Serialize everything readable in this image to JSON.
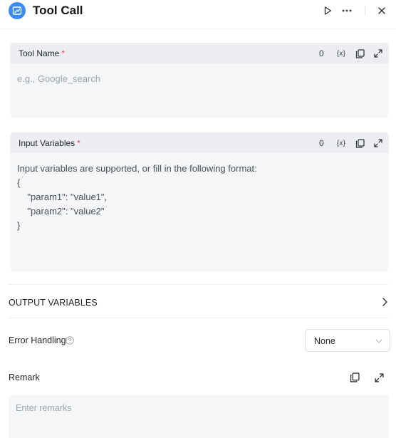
{
  "header": {
    "title": "Tool Call",
    "icon": "tool-node-icon",
    "actions": [
      "run-icon",
      "more-icon",
      "close-icon"
    ],
    "accent_color": "#3b8bf5"
  },
  "tool_name": {
    "label": "Tool Name",
    "required_mark": "*",
    "count": "0",
    "variable_button": "{x}",
    "placeholder": "e.g., Google_search"
  },
  "input_variables": {
    "label": "Input Variables",
    "required_mark": "*",
    "count": "0",
    "variable_button": "{x}",
    "placeholder_lines": [
      "Input variables are supported, or fill in the following format:",
      "{",
      "    \"param1\": \"value1\",",
      "    \"param2\": \"value2\"",
      "}"
    ]
  },
  "output_variables": {
    "title": "OUTPUT VARIABLES"
  },
  "error_handling": {
    "label": "Error Handling",
    "selected": "None"
  },
  "remark": {
    "label": "Remark",
    "placeholder": "Enter remarks"
  }
}
